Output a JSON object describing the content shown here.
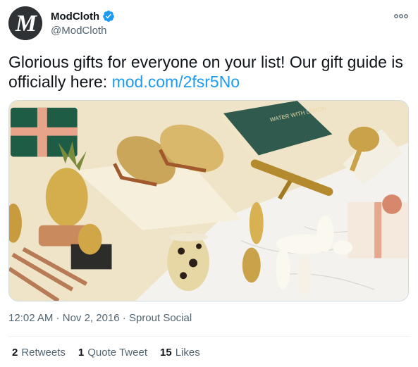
{
  "tweet": {
    "author": {
      "display_name": "ModCloth",
      "handle": "@ModCloth",
      "avatar_letter": "M",
      "verified": true
    },
    "text_before_link": "Glorious gifts for everyone on your list! Our gift guide is officially here: ",
    "link_text": "mod.com/2fsr5No",
    "media": {
      "book_title": "WATER WITH LEMON"
    },
    "meta": {
      "time": "12:02 AM",
      "separator": " · ",
      "date": "Nov 2, 2016",
      "source": "Sprout Social"
    },
    "stats": [
      {
        "count": "2",
        "label": "Retweets"
      },
      {
        "count": "1",
        "label": "Quote Tweet"
      },
      {
        "count": "15",
        "label": "Likes"
      }
    ]
  },
  "colors": {
    "link": "#1d9bf0",
    "secondary_text": "#536471",
    "verified": "#1d9bf0"
  },
  "icons": [
    "avatar-m-logo",
    "verified-badge-icon",
    "more-options-icon"
  ]
}
